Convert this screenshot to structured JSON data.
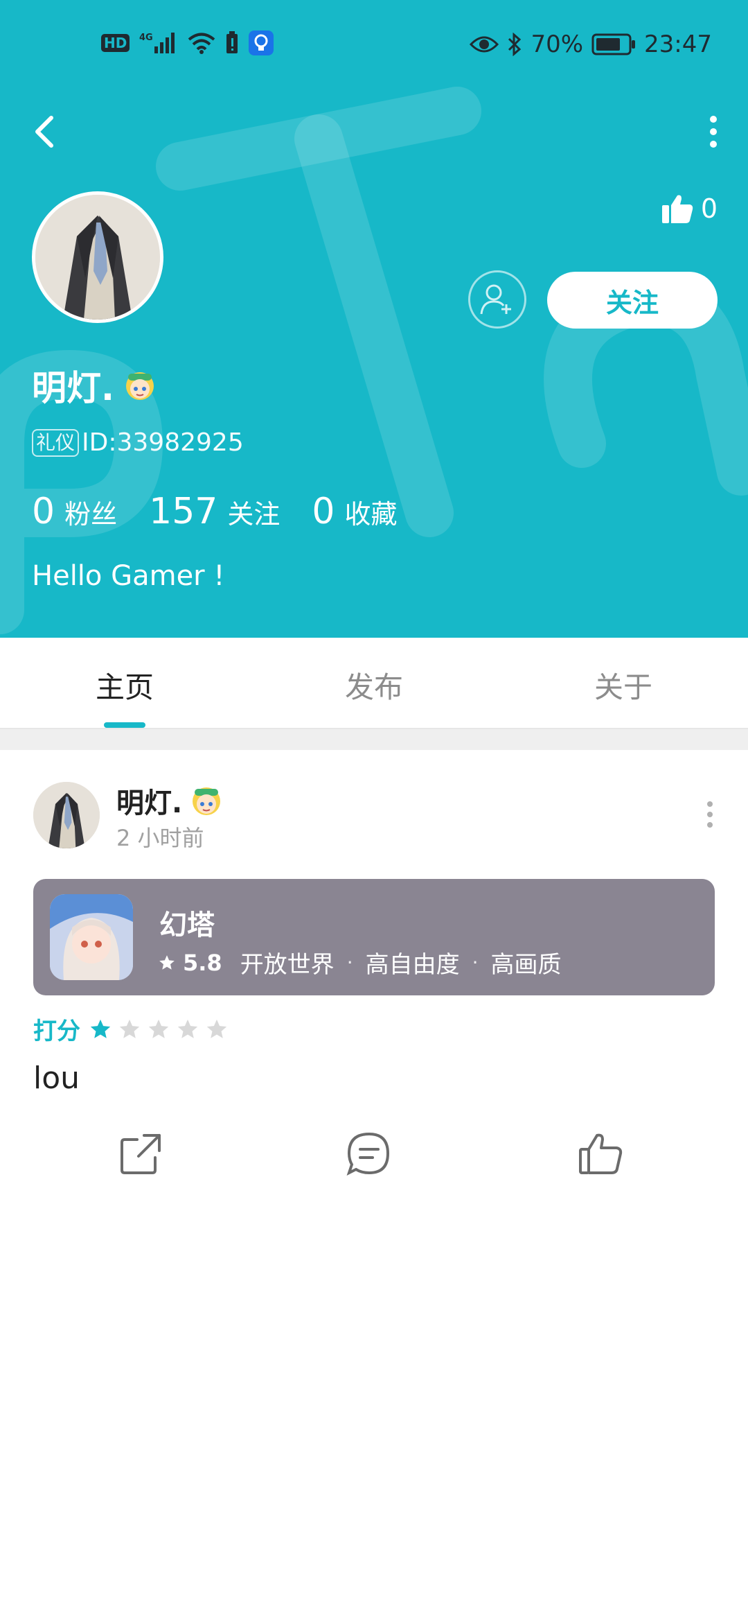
{
  "status_bar": {
    "hd_label": "HD",
    "network_label": "4G",
    "battery_percent": "70%",
    "time": "23:47"
  },
  "profile": {
    "like_count": "0",
    "follow_label": "关注",
    "nickname": "明灯.",
    "role_badge": "礼仪",
    "user_id": "ID:33982925",
    "stats": [
      {
        "value": "0",
        "label": "粉丝"
      },
      {
        "value": "157",
        "label": "关注"
      },
      {
        "value": "0",
        "label": "收藏"
      }
    ],
    "bio": "Hello Gamer !"
  },
  "tabs": [
    {
      "label": "主页",
      "active": true
    },
    {
      "label": "发布",
      "active": false
    },
    {
      "label": "关于",
      "active": false
    }
  ],
  "post": {
    "author": "明灯.",
    "time": "2 小时前",
    "game": {
      "title": "幻塔",
      "score": "5.8",
      "tags": [
        "开放世界",
        "高自由度",
        "高画质"
      ]
    },
    "rating_label": "打分",
    "rating": 1,
    "rating_max": 5,
    "content": "lou"
  },
  "colors": {
    "accent": "#17b8c8",
    "game_card_bg": "#8a8592",
    "star_empty": "#d8d8d8"
  }
}
